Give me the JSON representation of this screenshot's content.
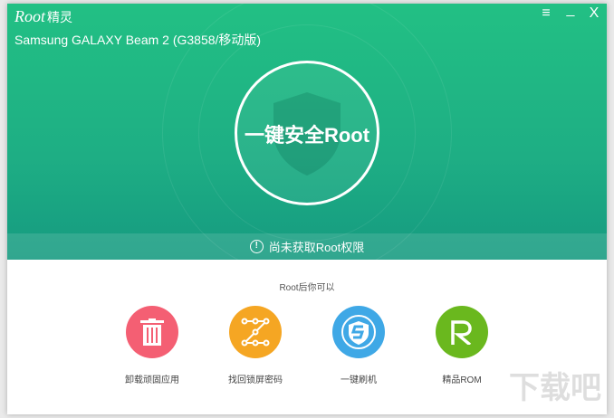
{
  "app": {
    "logo": "Root",
    "logo_cn": "精灵",
    "device": "Samsung GALAXY Beam 2 (G3858/移动版)"
  },
  "window_controls": {
    "menu": "≡",
    "minimize": "_",
    "close": "X"
  },
  "main": {
    "root_button": "一键安全Root",
    "status": "尚未获取Root权限",
    "status_icon": "!"
  },
  "features": {
    "subtitle": "Root后你可以",
    "items": [
      {
        "label": "卸载顽固应用",
        "icon": "trash-icon",
        "color": "#f45f73"
      },
      {
        "label": "找回锁屏密码",
        "icon": "pattern-lock-icon",
        "color": "#f5a623"
      },
      {
        "label": "一键刷机",
        "icon": "shield-s-icon",
        "color": "#3fa8e6"
      },
      {
        "label": "精品ROM",
        "icon": "rom-r-icon",
        "color": "#6ab81e"
      }
    ]
  },
  "watermark": "下载吧"
}
